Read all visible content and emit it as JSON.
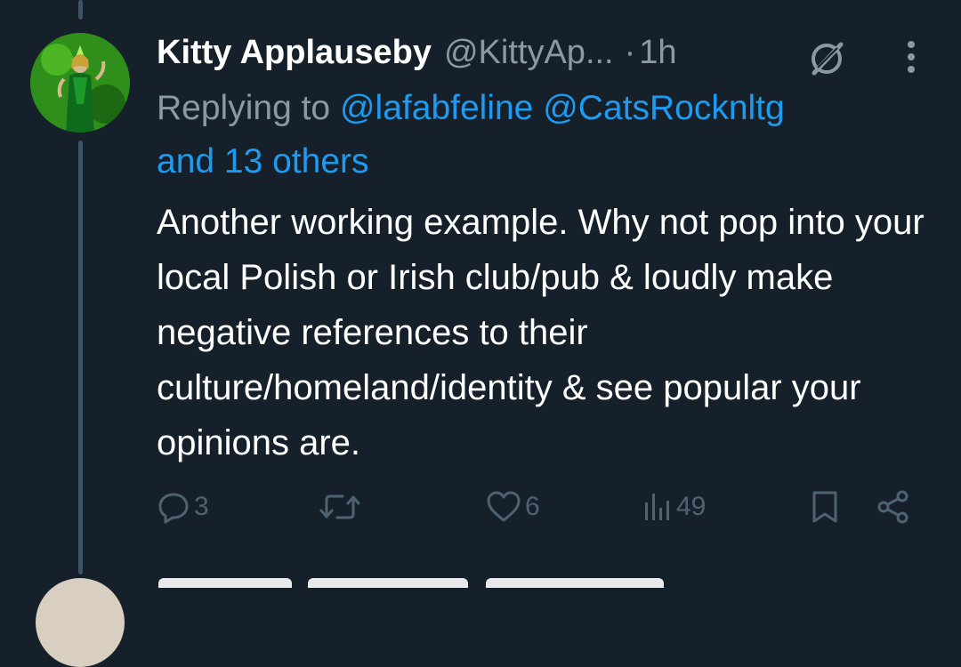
{
  "tweet": {
    "author_name": "Kitty Applauseby",
    "author_handle": "@KittyAp...",
    "separator": "·",
    "timestamp": "1h",
    "replying_prefix": "Replying to",
    "mention_1": "@lafabfeline",
    "mention_2": "@CatsRocknltg",
    "and_others": "and 13 others",
    "text": "Another working example. Why not pop into your local Polish or Irish club/pub & loudly make negative references to their culture/homeland/identity & see popular your opinions are."
  },
  "actions": {
    "replies": "3",
    "likes": "6",
    "views": "49"
  },
  "icons": {
    "grok": "grok-icon",
    "more": "more-vertical-icon",
    "reply": "reply-icon",
    "retweet": "retweet-icon",
    "like": "heart-icon",
    "views": "views-chart-icon",
    "bookmark": "bookmark-icon",
    "share": "share-icon"
  },
  "colors": {
    "background": "#15202b",
    "link": "#1d9bf0",
    "secondary_text": "#8b98a5",
    "action_icon": "#4e6272"
  }
}
